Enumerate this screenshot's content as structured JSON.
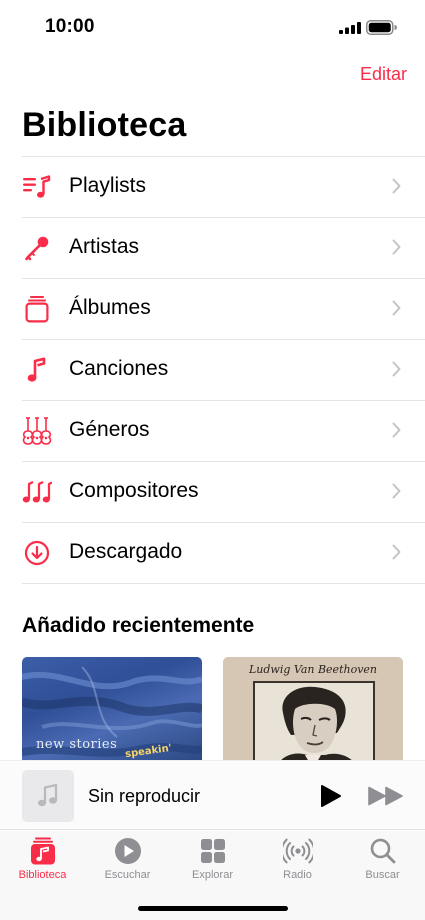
{
  "status_bar": {
    "time": "10:00"
  },
  "header": {
    "edit_label": "Editar",
    "title": "Biblioteca"
  },
  "library": {
    "items": [
      {
        "label": "Playlists",
        "icon": "playlist-icon"
      },
      {
        "label": "Artistas",
        "icon": "microphone-icon"
      },
      {
        "label": "Álbumes",
        "icon": "album-stack-icon"
      },
      {
        "label": "Canciones",
        "icon": "music-note-icon"
      },
      {
        "label": "Géneros",
        "icon": "guitars-icon"
      },
      {
        "label": "Compositores",
        "icon": "notes-icon"
      },
      {
        "label": "Descargado",
        "icon": "download-icon"
      }
    ]
  },
  "recent": {
    "title": "Añadido recientemente",
    "albums": [
      {
        "cover_text": "new stories",
        "cover_subtext": "speakin'"
      },
      {
        "cover_text": "Ludwig Van Beethoven"
      }
    ]
  },
  "mini_player": {
    "title": "Sin reproducir"
  },
  "tab_bar": {
    "tabs": [
      {
        "label": "Biblioteca",
        "icon": "library-icon",
        "active": true
      },
      {
        "label": "Escuchar",
        "icon": "play-circle-icon",
        "active": false
      },
      {
        "label": "Explorar",
        "icon": "grid-icon",
        "active": false
      },
      {
        "label": "Radio",
        "icon": "radio-icon",
        "active": false
      },
      {
        "label": "Buscar",
        "icon": "search-icon",
        "active": false
      }
    ]
  },
  "colors": {
    "accent": "#fa2d48",
    "inactive": "#8e8e93",
    "separator": "#e4e4e6"
  }
}
